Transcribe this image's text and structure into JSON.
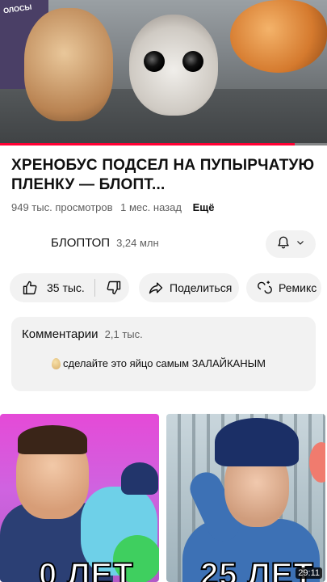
{
  "video": {
    "title": "ХРЕНОБУС ПОДСЕЛ НА ПУПЫРЧАТУЮ ПЛЕНКУ — БЛОПТ...",
    "views": "949 тыс. просмотров",
    "published": "1 мес. назад",
    "more_label": "Ещё",
    "progress": 0.9,
    "scene_sign": "ОЛОСЫ"
  },
  "channel": {
    "name": "БЛОПТОП",
    "subscribers": "3,24 млн"
  },
  "actions": {
    "likes": "35 тыс.",
    "share_label": "Поделиться",
    "remix_label": "Ремикс"
  },
  "comments": {
    "title": "Комментарии",
    "count": "2,1 тыс.",
    "top_comment": "сделайте это яйцо самым ЗАЛАЙКАНЫМ"
  },
  "recommendations": [
    {
      "overlay_text": "0 ЛЕТ"
    },
    {
      "overlay_text": "25 ЛЕТ",
      "duration": "29:11"
    }
  ],
  "colors": {
    "progress": "#ff0033",
    "pill_bg": "#f2f2f2"
  }
}
